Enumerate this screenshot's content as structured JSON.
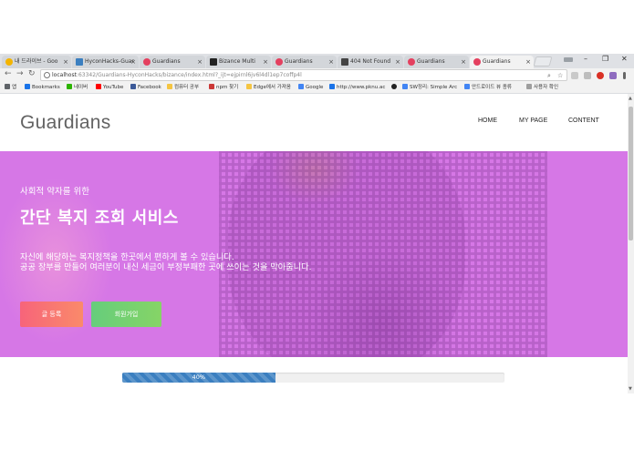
{
  "browser": {
    "tabs": [
      {
        "label": "내 드라이브 - Goo",
        "color": "#f4b400"
      },
      {
        "label": "HyconHacks-Guar",
        "color": "#3b7fc0"
      },
      {
        "label": "Guardians",
        "color": "#e4405f"
      },
      {
        "label": "Bizance Multi",
        "color": "#222222"
      },
      {
        "label": "Guardians",
        "color": "#e4405f"
      },
      {
        "label": "404 Not Found",
        "color": "#444444"
      },
      {
        "label": "Guardians",
        "color": "#e4405f"
      },
      {
        "label": "Guardians",
        "color": "#e4405f"
      }
    ],
    "address": {
      "host": "localhost",
      "path": ":63342/Guardians-HyconHacks/bizance/index.html?_ijt=ejpirnl6jv6l4dl1ep7coffp4l"
    },
    "bookmarks": [
      {
        "label": "앱",
        "color": "#5f6368"
      },
      {
        "label": "Bookmarks",
        "color": "#1a73e8"
      },
      {
        "label": "네이버",
        "color": "#2db400"
      },
      {
        "label": "YouTube",
        "color": "#ff0000"
      },
      {
        "label": "Facebook",
        "color": "#3b5998"
      },
      {
        "label": "컴퓨터 공부",
        "color": "#f5c542"
      },
      {
        "label": "npm 찾기",
        "color": "#cb3837"
      },
      {
        "label": "Edge에서 가져옴",
        "color": "#f5c542"
      },
      {
        "label": "Google",
        "color": "#4285f4"
      },
      {
        "label": "http://www.pknu.ac",
        "color": "#1a73e8"
      },
      {
        "label": "",
        "color": "#222222"
      },
      {
        "label": "SW정리: Simple Arc",
        "color": "#4285f4"
      },
      {
        "label": "안드로이드 뷰 종류",
        "color": "#4285f4"
      },
      {
        "label": "사용자 확인",
        "color": "#9e9e9e"
      }
    ]
  },
  "header": {
    "brand": "Guardians",
    "nav": [
      "HOME",
      "MY PAGE",
      "CONTENT"
    ]
  },
  "hero": {
    "subtitle": "사회적 약자를 위한",
    "title": "간단 복지 조회 서비스",
    "desc_line1": "자신에 해당하는 복지정책을 한곳에서 편하게 볼 수 있습니다.",
    "desc_line2": "공공 장부를 만들어 여러분이 내신 세금이 부정부패한 곳에 쓰이는 것을 막아줍니다.",
    "btn_post": "글 등록",
    "btn_join": "회원가입"
  },
  "progress": {
    "label": "40%",
    "value": 0.4
  },
  "colors": {
    "hero": "#d677e6",
    "progress": "#3b7fc0",
    "btn_post": "#f7647a",
    "btn_join": "#66cd7c"
  }
}
